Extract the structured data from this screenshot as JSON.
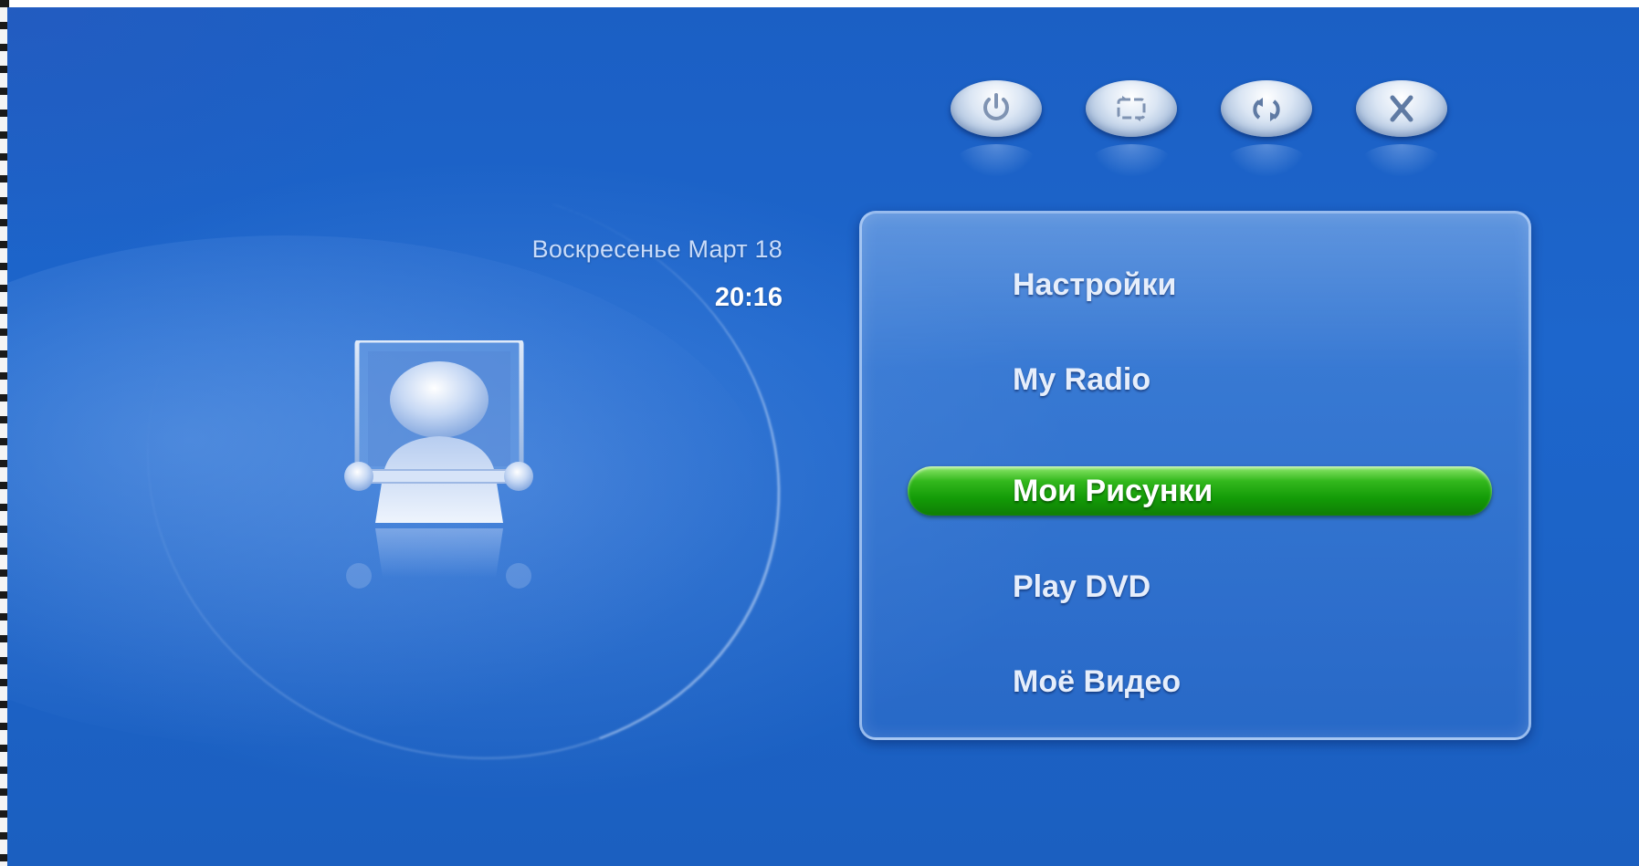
{
  "header": {
    "date": "Воскресенье Март 18",
    "time": "20:16"
  },
  "top_buttons": [
    {
      "icon": "power-icon"
    },
    {
      "icon": "window-switch-icon"
    },
    {
      "icon": "refresh-icon"
    },
    {
      "icon": "close-icon"
    }
  ],
  "menu": {
    "items": [
      {
        "label": "Настройки",
        "selected": false
      },
      {
        "label": "My Radio",
        "selected": false
      },
      {
        "label": "Мои Рисунки",
        "selected": true
      },
      {
        "label": "Play DVD",
        "selected": false
      },
      {
        "label": "Moё Видео",
        "selected": false
      }
    ]
  },
  "colors": {
    "background": "#1d66cc",
    "selected_bar": "#139b07",
    "menu_text": "#e6eefb",
    "date_text": "#c9dcfa"
  }
}
